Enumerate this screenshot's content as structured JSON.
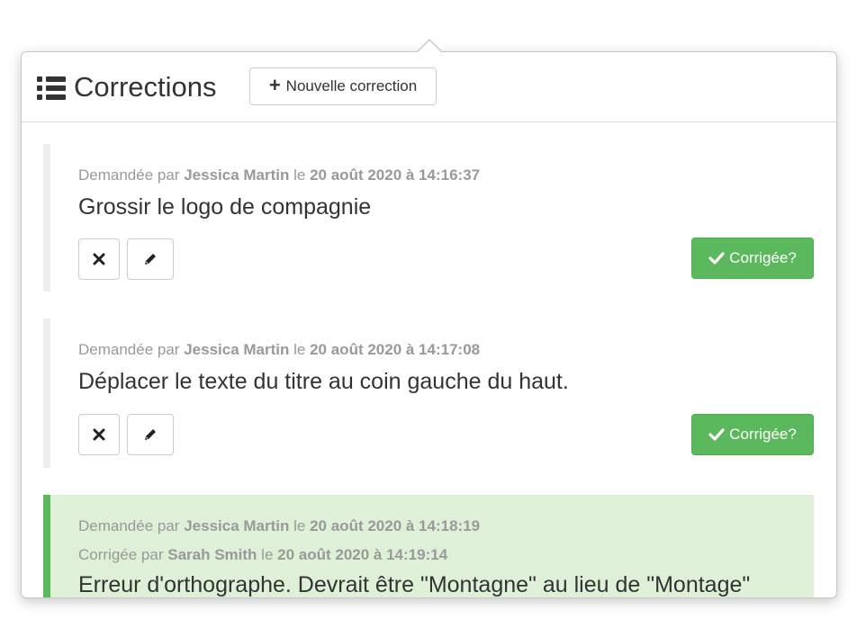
{
  "header": {
    "title": "Corrections",
    "new_button_label": "Nouvelle correction",
    "list_icon": "list-icon",
    "plus_icon": "plus-icon"
  },
  "colors": {
    "success": "#5cb85c",
    "corrected_bg": "#dff0d8",
    "muted_text": "#999999"
  },
  "items": [
    {
      "requested_prefix": "Demandée par",
      "requested_by": "Jessica Martin",
      "requested_mid": "le",
      "requested_at": "20 août 2020 à 14:16:37",
      "text": "Grossir le logo de compagnie",
      "delete_icon": "close-icon",
      "edit_icon": "pencil-icon",
      "corrected_label": "Corrigée?"
    },
    {
      "requested_prefix": "Demandée par",
      "requested_by": "Jessica Martin",
      "requested_mid": "le",
      "requested_at": "20 août 2020 à 14:17:08",
      "text": "Déplacer le texte du titre au coin gauche du haut.",
      "delete_icon": "close-icon",
      "edit_icon": "pencil-icon",
      "corrected_label": "Corrigée?"
    },
    {
      "requested_prefix": "Demandée par",
      "requested_by": "Jessica Martin",
      "requested_mid": "le",
      "requested_at": "20 août 2020 à 14:18:19",
      "corrected_prefix": "Corrigée par",
      "corrected_by": "Sarah Smith",
      "corrected_mid": "le",
      "corrected_at": "20 août 2020 à 14:19:14",
      "text": "Erreur d'orthographe. Devrait être \"Montagne\" au lieu de \"Montage\""
    }
  ]
}
